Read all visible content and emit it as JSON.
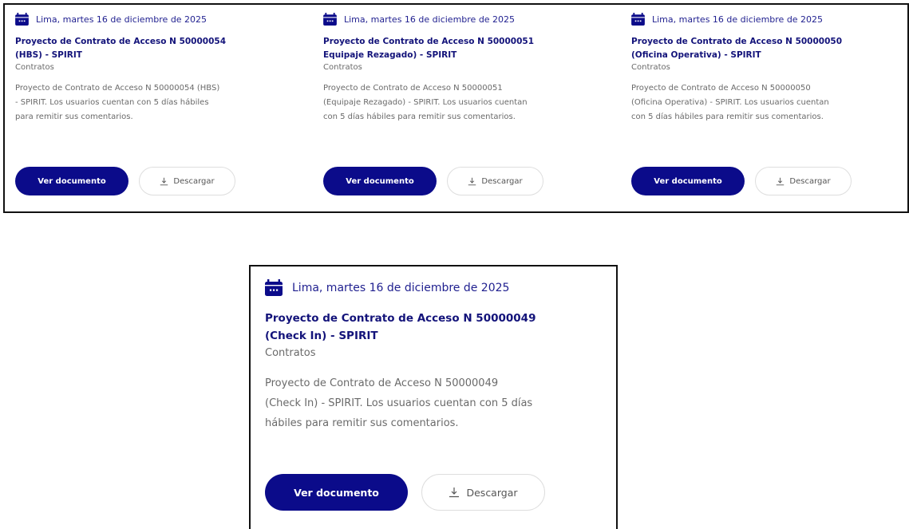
{
  "accent_color": "#0b0b8a",
  "date_icon": "calendar-icon",
  "download_icon": "download-icon",
  "cards": [
    {
      "date": "Lima, martes 16 de diciembre de 2025",
      "title_line1": "Proyecto de Contrato de Acceso N 50000054",
      "title_line2": "(HBS) - SPIRIT",
      "category": "Contratos",
      "desc_line1": "Proyecto de Contrato de Acceso N 50000054 (HBS)",
      "desc_line2": "- SPIRIT. Los usuarios cuentan con 5 días hábiles",
      "desc_line3": "para remitir sus comentarios.",
      "view_label": "Ver documento",
      "download_label": "Descargar"
    },
    {
      "date": "Lima, martes 16 de diciembre de 2025",
      "title_line1": "Proyecto de Contrato de Acceso N 50000051",
      "title_line2": "Equipaje Rezagado) - SPIRIT",
      "category": "Contratos",
      "desc_line1": "Proyecto de Contrato de Acceso N 50000051",
      "desc_line2": "(Equipaje Rezagado) - SPIRIT. Los usuarios cuentan",
      "desc_line3": "con 5 días hábiles para remitir sus comentarios.",
      "view_label": "Ver documento",
      "download_label": "Descargar"
    },
    {
      "date": "Lima, martes 16 de diciembre de 2025",
      "title_line1": "Proyecto de Contrato de Acceso N 50000050",
      "title_line2": "(Oficina Operativa) - SPIRIT",
      "category": "Contratos",
      "desc_line1": "Proyecto de Contrato de Acceso N 50000050",
      "desc_line2": "(Oficina Operativa) - SPIRIT. Los usuarios cuentan",
      "desc_line3": "con 5 días hábiles para remitir sus comentarios.",
      "view_label": "Ver documento",
      "download_label": "Descargar"
    },
    {
      "date": "Lima, martes 16 de diciembre de 2025",
      "title_line1": "Proyecto de Contrato de Acceso N 50000049",
      "title_line2": "(Check In) - SPIRIT",
      "category": "Contratos",
      "desc_line1": "Proyecto de Contrato de Acceso N 50000049",
      "desc_line2": "(Check In) - SPIRIT. Los usuarios cuentan con 5 días",
      "desc_line3": "hábiles para remitir sus comentarios.",
      "view_label": "Ver documento",
      "download_label": "Descargar"
    }
  ]
}
